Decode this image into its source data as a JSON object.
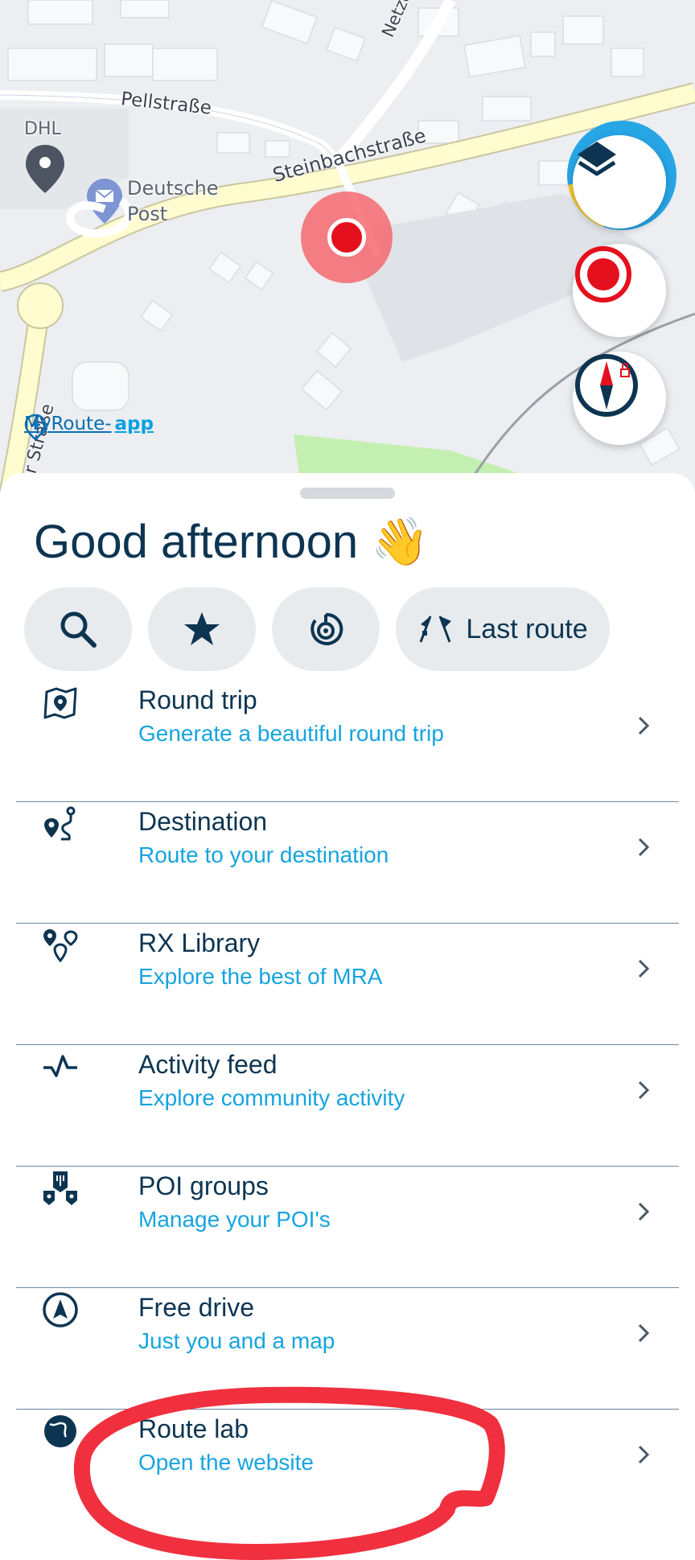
{
  "map": {
    "labels": {
      "pellstrasse": "Pellstraße",
      "netzerstrasse": "Netzerstraße",
      "steinbachstrasse": "Steinbachstraße",
      "dhl": "DHL",
      "deutsche_post_line1": "Deutsche",
      "deutsche_post_line2": "Post",
      "partial_street": "er Straße"
    },
    "attribution": {
      "part1": "MyRoute-",
      "part2": "app"
    },
    "buttons": {
      "layers": "layers-icon",
      "record": "record-icon",
      "compass": "compass-icon"
    }
  },
  "sheet": {
    "greeting": "Good afternoon 👋",
    "chips": [
      {
        "icon": "search-icon"
      },
      {
        "icon": "star-icon"
      },
      {
        "icon": "location-target-icon"
      },
      {
        "icon": "checkered-flags-icon",
        "label": "Last route"
      }
    ],
    "menu": [
      {
        "title": "Round trip",
        "subtitle": "Generate a beautiful round trip",
        "icon": "round-trip-icon"
      },
      {
        "title": "Destination",
        "subtitle": "Route to your destination",
        "icon": "destination-icon"
      },
      {
        "title": "RX Library",
        "subtitle": "Explore the best of MRA",
        "icon": "library-pins-icon"
      },
      {
        "title": "Activity feed",
        "subtitle": "Explore community activity",
        "icon": "activity-pulse-icon"
      },
      {
        "title": "POI groups",
        "subtitle": "Manage your POI's",
        "icon": "poi-groups-icon"
      },
      {
        "title": "Free drive",
        "subtitle": "Just you and a map",
        "icon": "navigation-arrow-icon"
      },
      {
        "title": "Route lab",
        "subtitle": "Open the website",
        "icon": "globe-icon"
      }
    ]
  },
  "colors": {
    "accent": "#16a4df",
    "text": "#0d3552",
    "record": "#e5101d",
    "annotation": "#f0303e"
  }
}
